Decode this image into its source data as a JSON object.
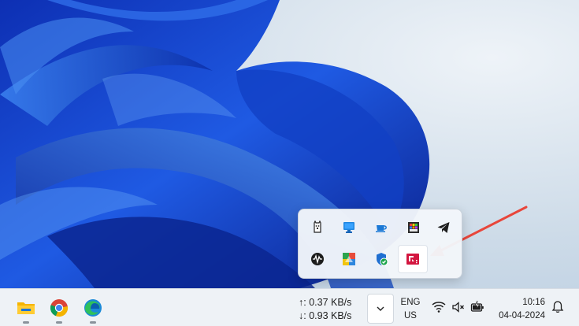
{
  "desktop": {
    "wallpaper": "Windows 11 bloom wallpaper",
    "colors": {
      "bloom_dark": "#0a1f8a",
      "bloom_mid": "#1a4fd6",
      "bloom_light": "#3d86f0",
      "sky": "#dce6f0"
    }
  },
  "tray_popup": {
    "icons": [
      {
        "name": "alpaca-app-icon"
      },
      {
        "name": "monitor-app-icon"
      },
      {
        "name": "coffee-cup-icon"
      },
      {
        "name": "color-chart-app-icon"
      },
      {
        "name": "telegram-icon"
      },
      {
        "name": "audio-wave-icon"
      },
      {
        "name": "colorful-grid-app-icon"
      },
      {
        "name": "windows-security-icon"
      },
      {
        "name": "red-app-icon"
      }
    ],
    "highlighted_icon": "red-app-icon",
    "annotation_color": "#e8463b"
  },
  "taskbar": {
    "apps": [
      {
        "name": "file-explorer-icon"
      },
      {
        "name": "chrome-icon"
      },
      {
        "name": "edge-icon"
      }
    ],
    "network": {
      "upload": "↑: 0.37 KB/s",
      "download": "↓: 0.93 KB/s"
    },
    "language": {
      "line1": "ENG",
      "line2": "US"
    },
    "clock": {
      "time": "10:16",
      "date": "04-04-2024"
    }
  }
}
